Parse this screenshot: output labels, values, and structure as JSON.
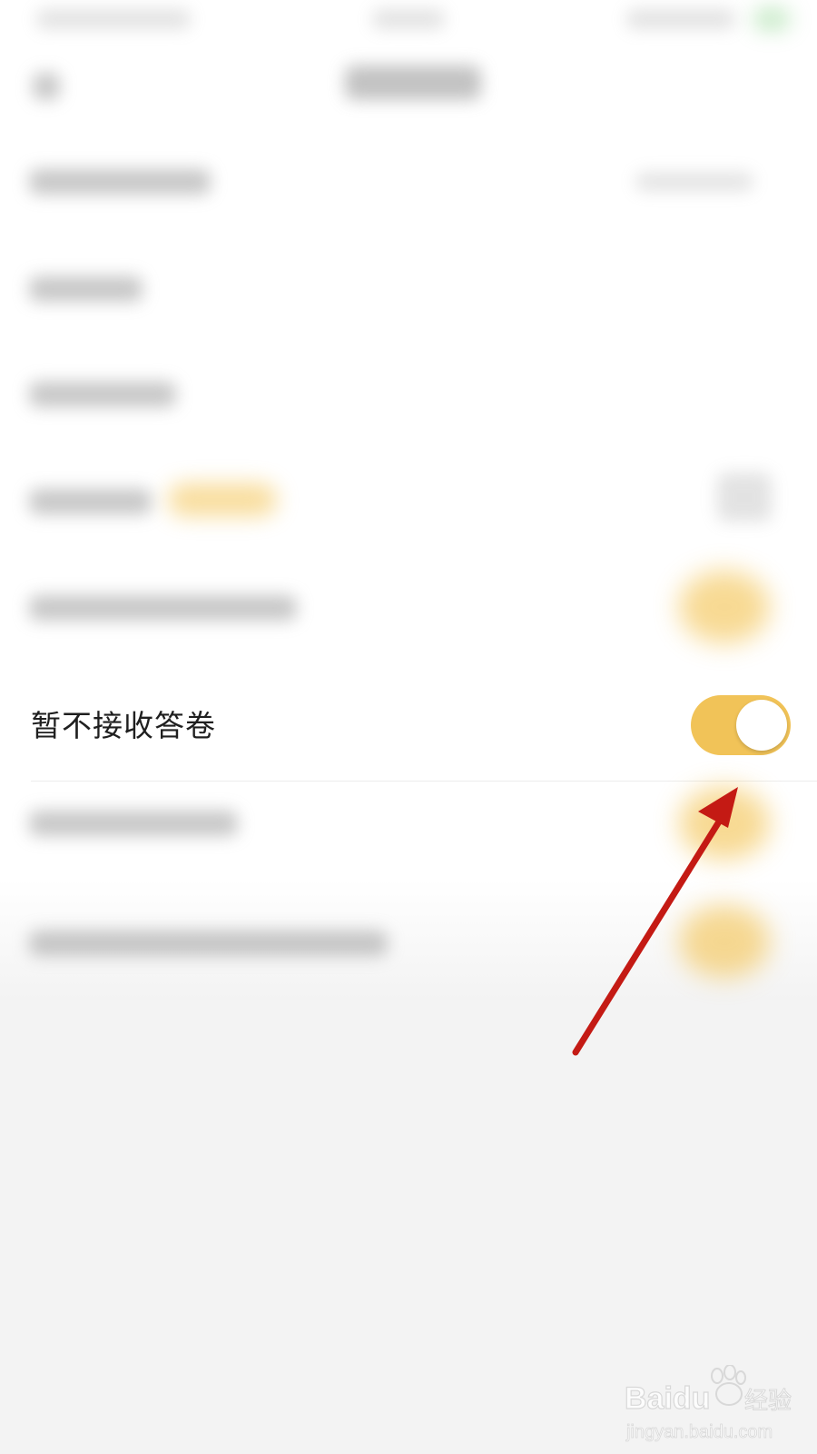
{
  "settings": {
    "highlighted_row": {
      "label": "暂不接收答卷",
      "toggle_on": true
    }
  },
  "colors": {
    "toggle_on": "#f1c358",
    "arrow": "#c41a14",
    "background": "#f3f3f3"
  },
  "watermark": {
    "brand": "Baidu",
    "brand_cn": "经验",
    "url": "jingyan.baidu.com"
  }
}
